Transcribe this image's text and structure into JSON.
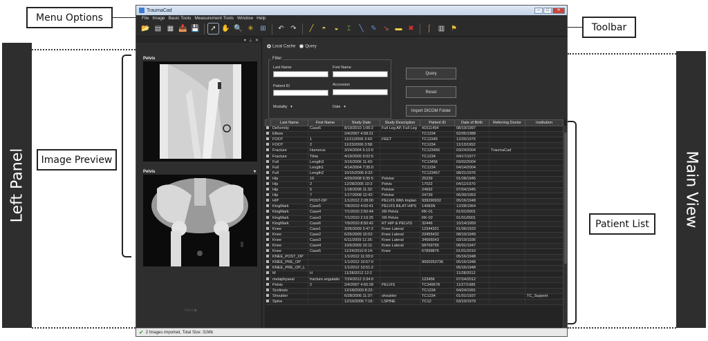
{
  "callouts": {
    "menu_options": "Menu Options",
    "toolbar": "Toolbar",
    "image_preview": "Image Preview",
    "patient_list": "Patient List",
    "left_panel": "Left Panel",
    "main_view": "Main View"
  },
  "window": {
    "title": "TraumaCad",
    "menu": [
      "File",
      "Image",
      "Basic Tools",
      "Measurement Tools",
      "Window",
      "Help"
    ]
  },
  "toolbar_icons": [
    {
      "name": "open-folder-icon",
      "glyph": "📂",
      "color": "#e0b040"
    },
    {
      "name": "new-image-icon",
      "glyph": "▤",
      "color": "#ddd"
    },
    {
      "name": "grid-icon",
      "glyph": "▦",
      "color": "#ddd"
    },
    {
      "name": "import-icon",
      "glyph": "📥",
      "color": "#e0b040"
    },
    {
      "name": "save-icon",
      "glyph": "💾",
      "color": "#6b8fd0"
    },
    {
      "name": "pointer-icon",
      "glyph": "➚",
      "color": "#eee"
    },
    {
      "name": "pan-hand-icon",
      "glyph": "✋",
      "color": "#e8c070"
    },
    {
      "name": "zoom-icon",
      "glyph": "🔍",
      "color": "#ddd"
    },
    {
      "name": "brightness-icon",
      "glyph": "✳",
      "color": "#f0c030"
    },
    {
      "name": "layout-icon",
      "glyph": "⊞",
      "color": "#8ab0e0"
    },
    {
      "name": "undo-icon",
      "glyph": "↶",
      "color": "#ddd"
    },
    {
      "name": "redo-icon",
      "glyph": "↷",
      "color": "#ddd"
    },
    {
      "name": "line-tool-icon",
      "glyph": "╱",
      "color": "#e8c040"
    },
    {
      "name": "circle-tool-icon",
      "glyph": "◓",
      "color": "#f0d060"
    },
    {
      "name": "angle-tool-icon",
      "glyph": "◒",
      "color": "#f0d060"
    },
    {
      "name": "ruler-tool-icon",
      "glyph": "⌶",
      "color": "#80c040"
    },
    {
      "name": "measure-line-icon",
      "glyph": "╲",
      "color": "#70a0e0"
    },
    {
      "name": "pen-tool-icon",
      "glyph": "✎",
      "color": "#6090e0"
    },
    {
      "name": "arrow-tool-icon",
      "glyph": "↘",
      "color": "#e05050"
    },
    {
      "name": "note-tool-icon",
      "glyph": "▬",
      "color": "#f0d040"
    },
    {
      "name": "delete-icon",
      "glyph": "✖",
      "color": "#e03030"
    },
    {
      "name": "implant-icon",
      "glyph": "⌠",
      "color": "#e0a060"
    },
    {
      "name": "template-icon",
      "glyph": "▥",
      "color": "#ddd"
    },
    {
      "name": "flag-icon",
      "glyph": "⚑",
      "color": "#e8c040"
    }
  ],
  "left_panel": {
    "thumbs": [
      {
        "label": "Pelvis"
      },
      {
        "label": "Pelvis"
      }
    ],
    "next_label": "Next ▶"
  },
  "main": {
    "source_local": "Local Cache",
    "source_query": "Query",
    "filter_legend": "Filter",
    "last_name_label": "Last Name",
    "first_name_label": "First Name",
    "patient_id_label": "Patient ID",
    "accession_label": "Accession",
    "modality_label": "Modality",
    "date_label": "Date",
    "query_button": "Query",
    "reset_button": "Reset",
    "import_button": "Import DICOM Folder"
  },
  "table": {
    "columns": [
      "Last Name",
      "First Name",
      "Study Date",
      "Study Description",
      "Patient ID",
      "Date of Birth",
      "Referring Doctor",
      "Institution"
    ],
    "rows": [
      [
        "Deformity",
        "Case6",
        "8/19/2010 1:06:2",
        "Full Leg AP, Full Leg",
        "41511494",
        "08/19/1997",
        "",
        ""
      ],
      [
        "Elbow",
        "",
        "2/4/2007 4:58:21",
        "",
        "TC1234",
        "02/05/1988",
        "",
        ""
      ],
      [
        "FOOT",
        "1",
        "11/21/2006 3:42:",
        "FEET",
        "TC12345",
        "12/20/1976",
        "",
        ""
      ],
      [
        "FOOT",
        "2",
        "11/23/2006 3:58:",
        "",
        "TC1234",
        "11/13/1952",
        "",
        ""
      ],
      [
        "Fracture",
        "Humerus",
        "3/24/2004 5:10:0",
        "",
        "TC123456",
        "03/24/2004",
        "TraumaCad",
        ""
      ],
      [
        "Fracture",
        "Tibia",
        "4/19/2005 9:02:5",
        "",
        "TC1234",
        "04/17/1977",
        "",
        ""
      ],
      [
        "Full",
        "Length3",
        "3/16/2006 11:43:",
        "",
        "TC13456",
        "03/02/2004",
        "",
        ""
      ],
      [
        "Full",
        "Length1",
        "4/14/2004 7:35:0",
        "",
        "TC1234",
        "04/14/2004",
        "",
        ""
      ],
      [
        "Full",
        "Length2",
        "10/15/2006 9:32:",
        "",
        "TC123457",
        "08/21/1976",
        "",
        ""
      ],
      [
        "Hip",
        "16",
        "4/29/2008 9:35:5",
        "Pelvise",
        "25239",
        "01/28/1945",
        "",
        ""
      ],
      [
        "Hip",
        "2",
        "12/28/2005 10:3",
        "Pelvis",
        "17022",
        "04/11/1970",
        "",
        ""
      ],
      [
        "Hip",
        "5",
        "1/18/2008 11:32:",
        "Pelvise",
        "24692",
        "07/04/1945",
        "",
        ""
      ],
      [
        "Hip",
        "7",
        "1/17/2008 12:42:",
        "Pelvise",
        "24739",
        "06/30/1953",
        "",
        ""
      ],
      [
        "HIP",
        "POST-OP",
        "1/1/2012 2:28:00",
        "PELVIS With Implan",
        "939290932",
        "05/16/1948",
        "",
        ""
      ],
      [
        "KingMark",
        "Case5",
        "7/8/2010 4:02:41",
        "PELVIS BILAT HIPS",
        "14083N",
        "12/28/1964",
        "",
        ""
      ],
      [
        "KingMark",
        "Case4",
        "7/1/2010 2:50:44",
        "XR Pelvis",
        "RK-01",
        "01/01/0001",
        "",
        ""
      ],
      [
        "KingMark",
        "Case3",
        "7/1/2010 2:19:25",
        "XR Pelvis",
        "RK-02",
        "01/01/0001",
        "",
        ""
      ],
      [
        "KingMark",
        "Case6",
        "7/9/2010 8:50:42",
        "RT HIP & PELVIS",
        "32446",
        "10/14/1959",
        "",
        ""
      ],
      [
        "Knee",
        "Case1",
        "3/26/2009 3:47:2",
        "Knee Lateral",
        "12344321",
        "01/06/1933",
        "",
        ""
      ],
      [
        "Knee",
        "Case2",
        "6/26/2009 10:52:",
        "Knee Lateral",
        "23455432",
        "08/10/1949",
        "",
        ""
      ],
      [
        "Knee",
        "Case3",
        "6/11/2009 11:26:",
        "Knee Lateral",
        "34566543",
        "03/19/1936",
        "",
        ""
      ],
      [
        "Knee",
        "Case4",
        "10/6/2009 10:11:",
        "Knee Lateral",
        "58769765",
        "06/01/1947",
        "",
        ""
      ],
      [
        "Knee",
        "Case5",
        "11/24/2010 8:14:",
        "Knee",
        "67899876",
        "01/01/2010",
        "",
        ""
      ],
      [
        "KNEE_POST_OP",
        "",
        "1/1/2012 11:03:0",
        "",
        "",
        "05/16/1948",
        "",
        ""
      ],
      [
        "KNEE_PRE_OP",
        "",
        "1/1/2012 10:57:0",
        "",
        "9000253736",
        "05/16/1948",
        "",
        ""
      ],
      [
        "KNEE_PRE_OP_L",
        "",
        "1/1/2012 10:51:2",
        "",
        "",
        "05/16/1948",
        "",
        ""
      ],
      [
        "M",
        "H",
        "11/28/2012 12:2",
        "",
        "",
        "11/28/2012",
        "",
        ""
      ],
      [
        "metaphyseal",
        "fracture angulatio",
        "7/24/2012 3:34:0",
        "",
        "123456",
        "07/24/2012",
        "",
        ""
      ],
      [
        "Pelvis",
        "2",
        "2/4/2007 4:50:28",
        "PELVIS",
        "TC349678",
        "11/27/1985",
        "",
        ""
      ],
      [
        "Scoliosis",
        "",
        "12/18/2003 8:22:",
        "",
        "TC1234",
        "04/24/1991",
        "",
        ""
      ],
      [
        "Shoulder",
        "",
        "6/28/2006 11:37:",
        "shoulder",
        "TC1234",
        "01/01/1937",
        "",
        "TC_Support"
      ],
      [
        "Spine",
        "",
        "12/10/2006 7:16:",
        "LSPINE",
        "TC12",
        "03/19/1979",
        "",
        ""
      ]
    ]
  },
  "status": {
    "text": "2 Images imported, Total Size: 31Mb"
  }
}
